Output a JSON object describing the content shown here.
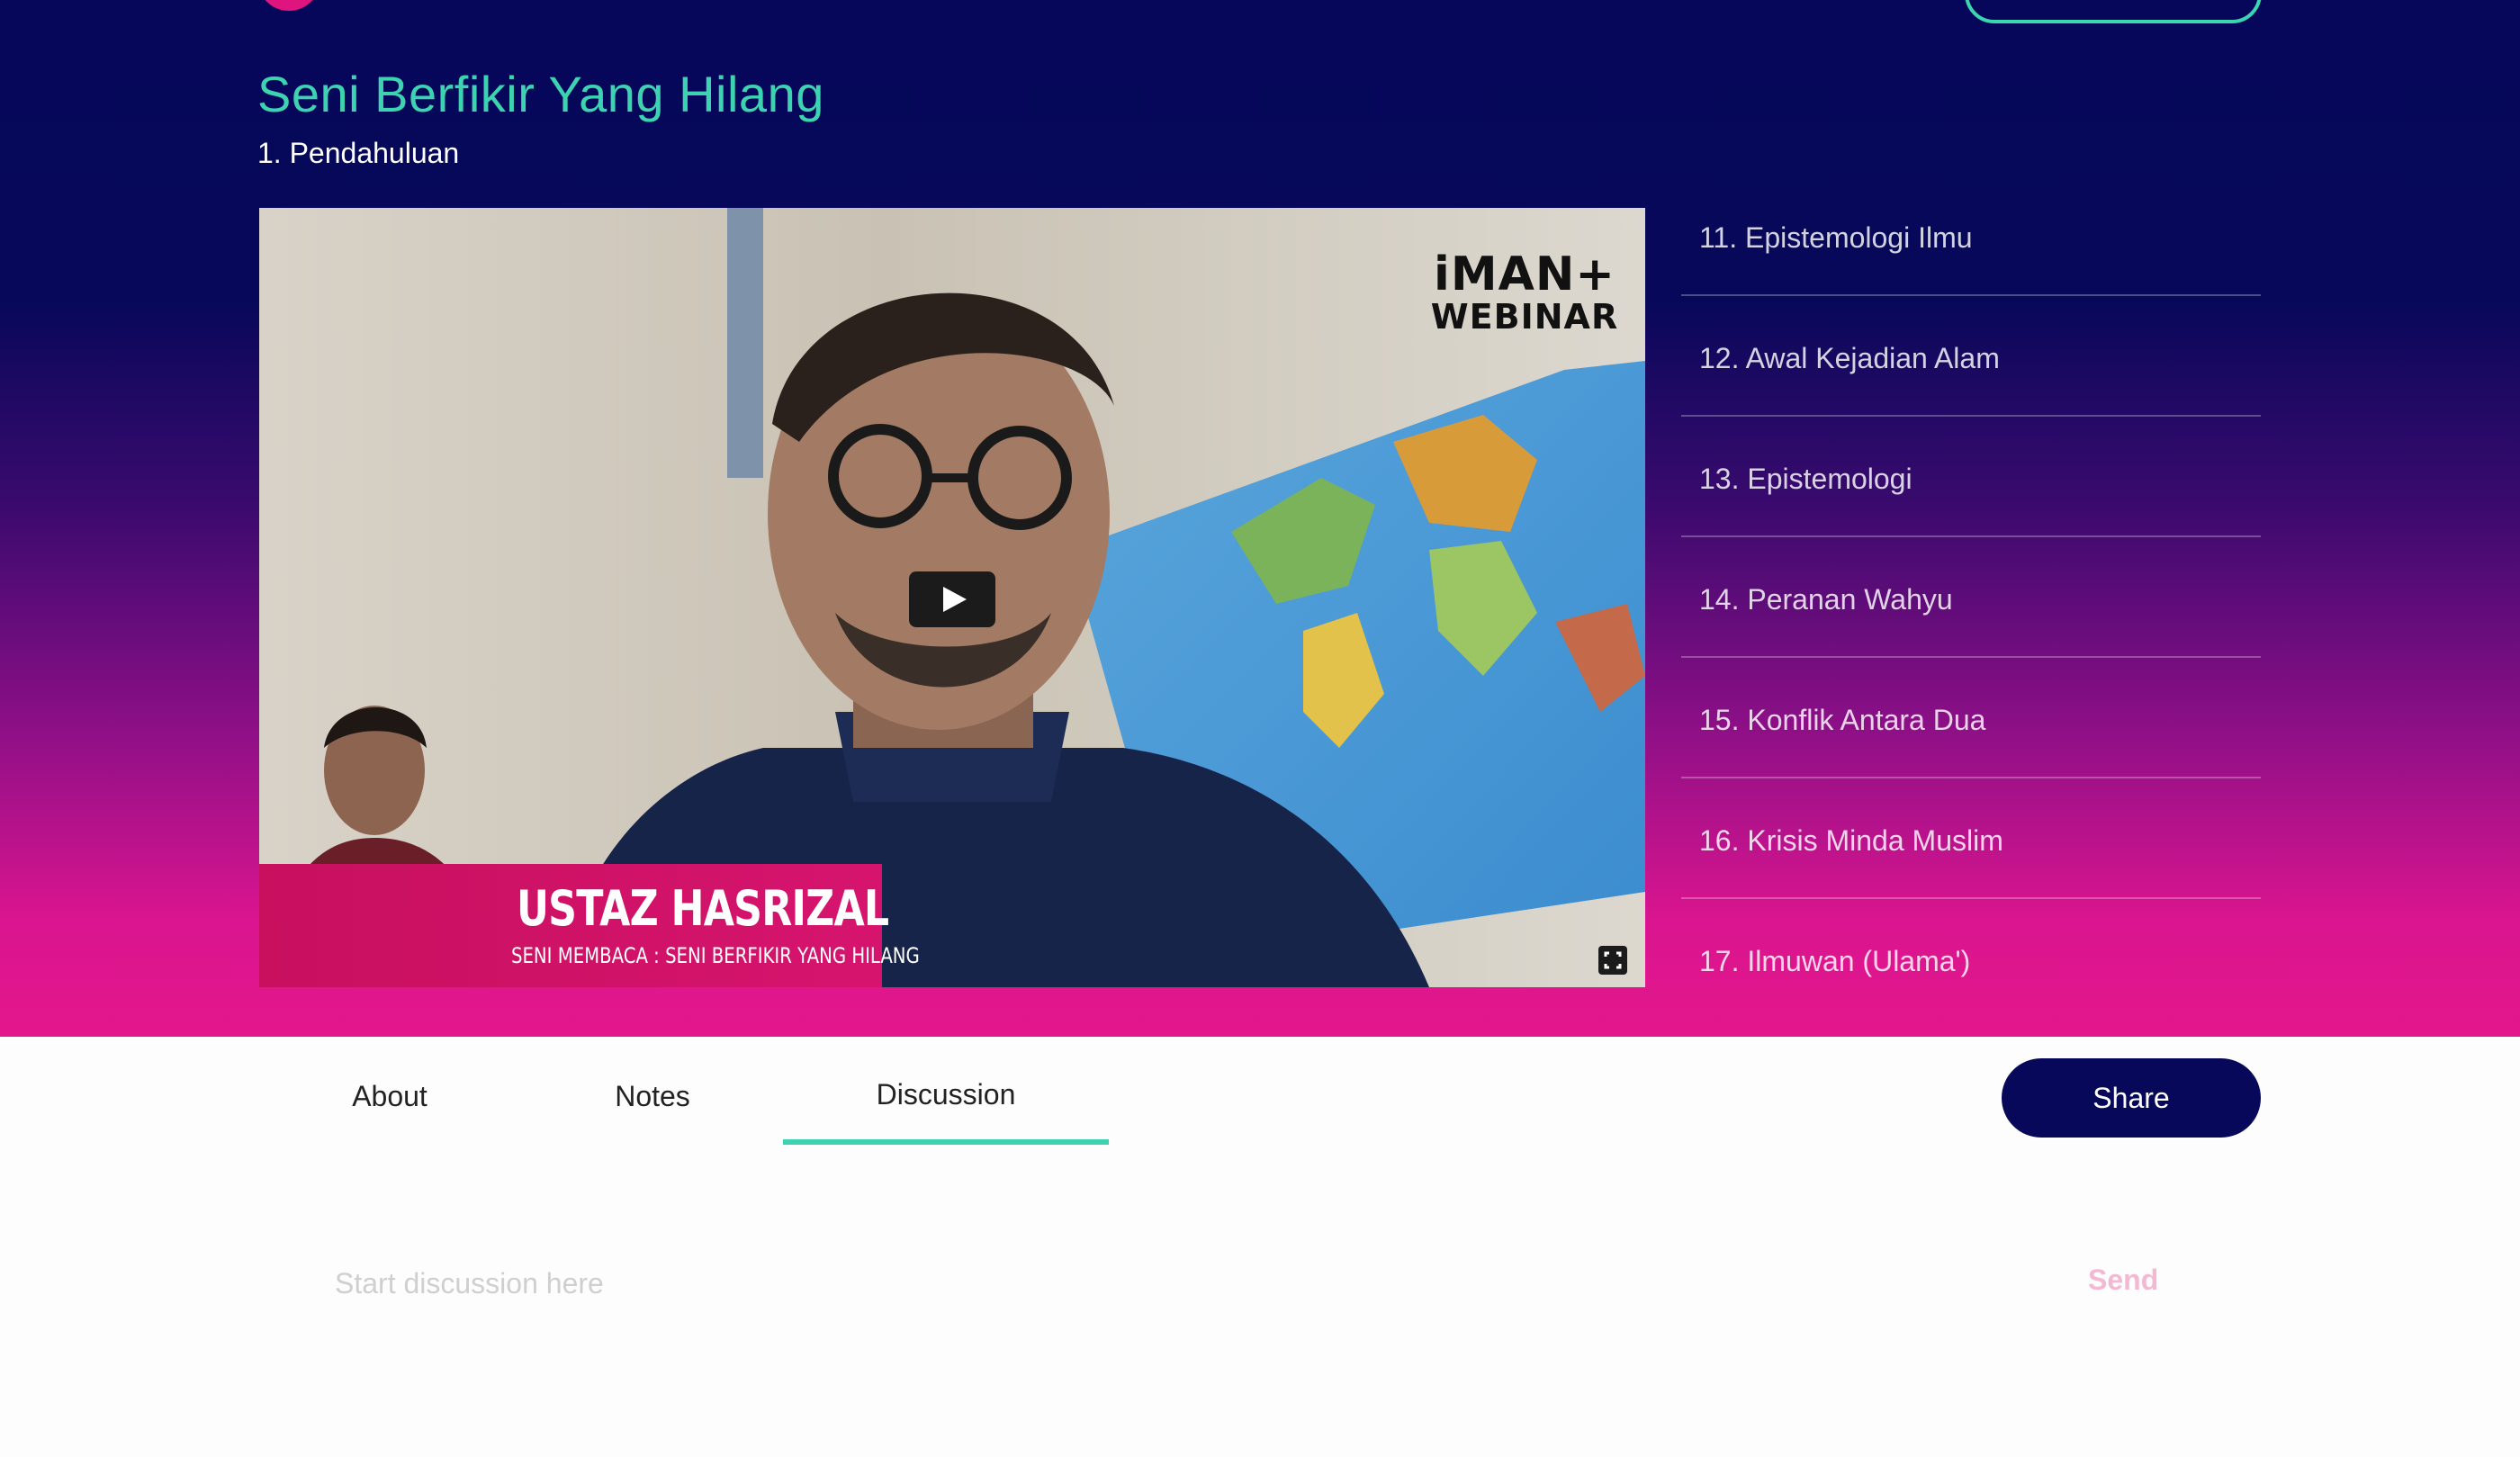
{
  "header": {
    "course_title": "Seni Berfikir Yang Hilang",
    "lesson_subtitle": "1. Pendahuluan"
  },
  "video": {
    "brand_line1": "iMAN+",
    "brand_line2": "WEBINAR",
    "presenter_name": "USTAZ HASRIZAL",
    "presenter_caption": "SENI MEMBACA : SENI BERFIKIR YANG HILANG",
    "play_icon": "play-icon",
    "fullscreen_icon": "fullscreen-icon"
  },
  "playlist": [
    {
      "label": "11. Epistemologi Ilmu"
    },
    {
      "label": "12. Awal Kejadian Alam"
    },
    {
      "label": "13. Epistemologi"
    },
    {
      "label": "14. Peranan Wahyu"
    },
    {
      "label": "15. Konflik Antara Dua"
    },
    {
      "label": "16. Krisis Minda Muslim"
    },
    {
      "label": "17. Ilmuwan (Ulama')"
    }
  ],
  "tabs": [
    {
      "label": "About"
    },
    {
      "label": "Notes"
    },
    {
      "label": "Discussion",
      "active": true
    }
  ],
  "share_label": "Share",
  "discussion": {
    "placeholder": "Start discussion here",
    "value": "",
    "send_label": "Send"
  },
  "colors": {
    "accent": "#3ed3b0",
    "navy": "#07085a",
    "magenta": "#e4168c"
  }
}
